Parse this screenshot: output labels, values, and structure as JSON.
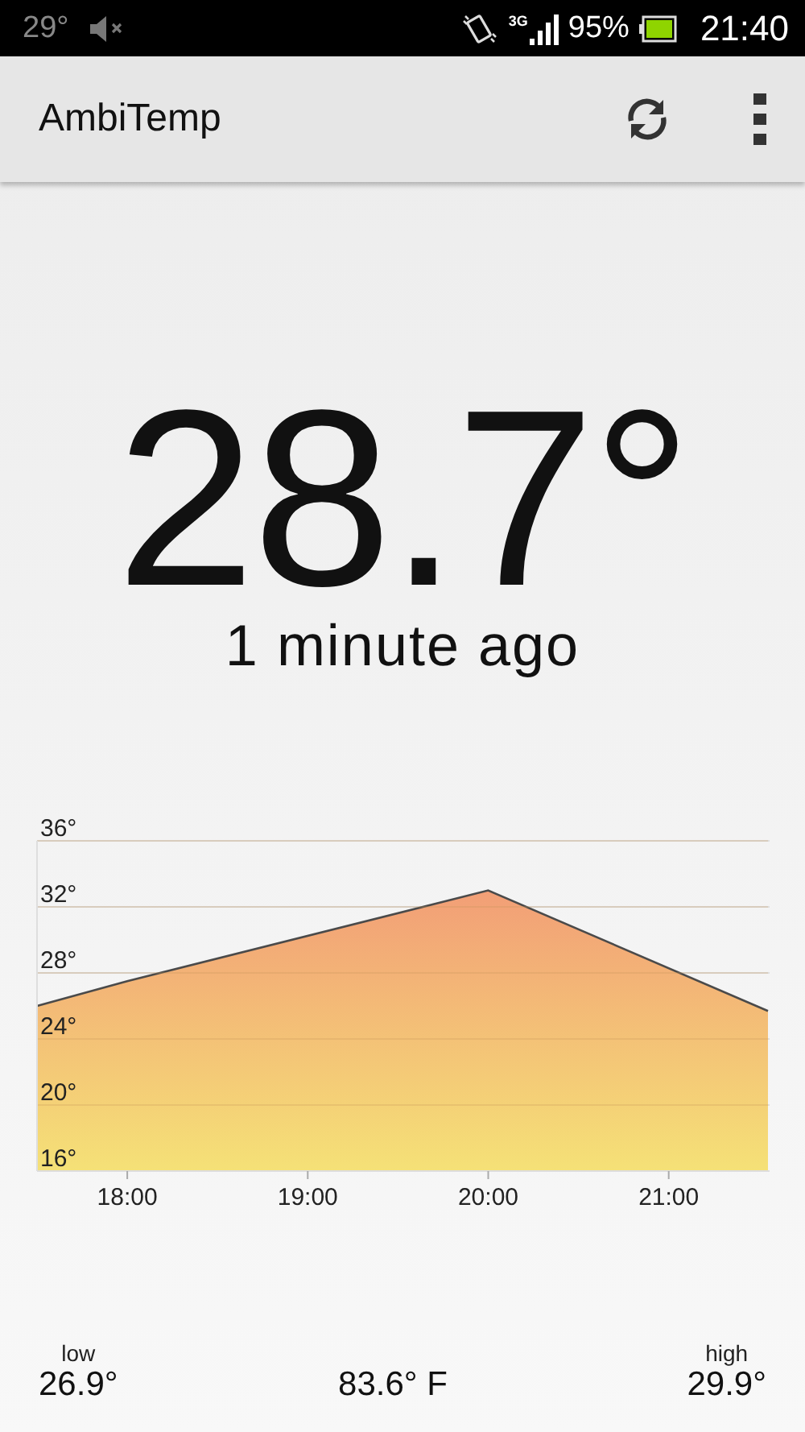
{
  "status_bar": {
    "temperature": "29°",
    "network": "3G",
    "battery": "95%",
    "time": "21:40"
  },
  "app_bar": {
    "title": "AmbiTemp"
  },
  "current": {
    "temperature": "28.7°",
    "updated": "1 minute ago"
  },
  "history": {
    "chart_data": {
      "type": "area",
      "x": [
        17.5,
        18.0,
        20.0,
        21.55
      ],
      "series": [
        {
          "color": "#f29a70",
          "values": [
            26.0,
            27.5,
            33.0,
            25.7
          ]
        }
      ],
      "grid": true,
      "xlim": [
        17.5,
        21.55
      ],
      "ylim": [
        16,
        36
      ],
      "xticks": [
        {
          "value": 18,
          "label": "18:00"
        },
        {
          "value": 19,
          "label": "19:00"
        },
        {
          "value": 20,
          "label": "20:00"
        },
        {
          "value": 21,
          "label": "21:00"
        }
      ],
      "yticks": [
        {
          "value": 16,
          "label": "16°"
        },
        {
          "value": 20,
          "label": "20°"
        },
        {
          "value": 24,
          "label": "24°"
        },
        {
          "value": 28,
          "label": "28°"
        },
        {
          "value": 32,
          "label": "32°"
        },
        {
          "value": 36,
          "label": "36°"
        }
      ]
    }
  },
  "summary": {
    "low": {
      "label": "low",
      "value": "26.9°"
    },
    "fahrenheit": "83.6° F",
    "high": {
      "label": "high",
      "value": "29.9°"
    }
  }
}
